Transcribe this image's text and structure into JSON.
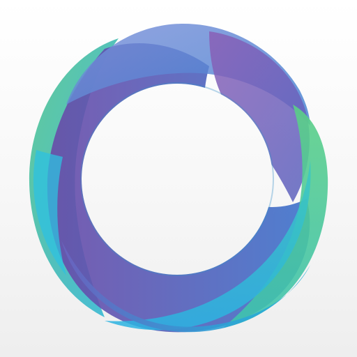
{
  "icon": {
    "name": "overlapping-ring-logo",
    "background": [
      "#ffffff",
      "#eeeeee"
    ],
    "colors": {
      "green": "#5fcf8a",
      "teal": "#2fb8c8",
      "cyan": "#27b3dc",
      "blue": "#3f86d6",
      "violet": "#6a58b0",
      "purple": "#7c5aae",
      "indigo": "#4f5fc0"
    }
  }
}
